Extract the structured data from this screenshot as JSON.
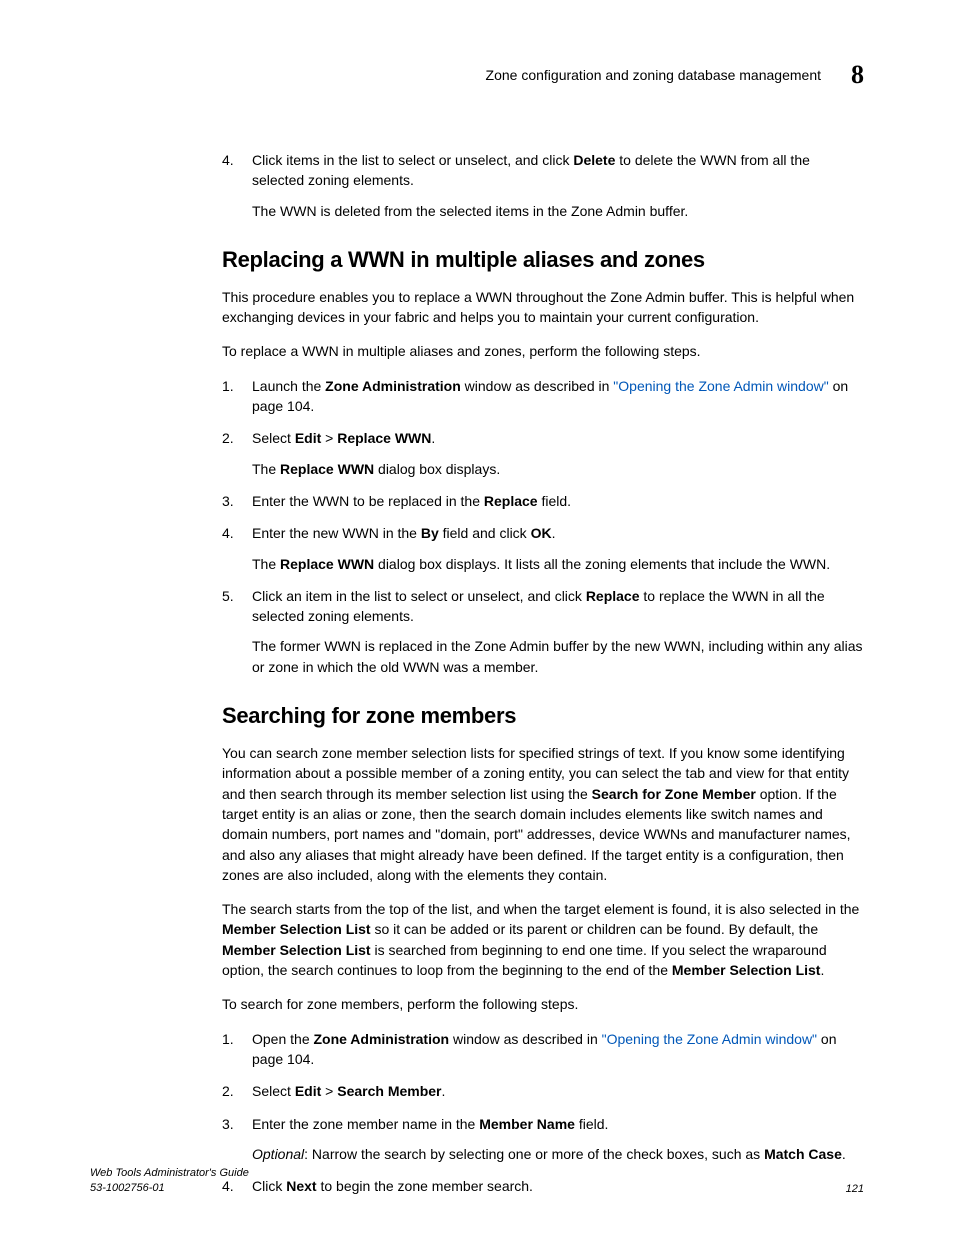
{
  "header": {
    "running_title": "Zone configuration and zoning database management",
    "chapter_number": "8"
  },
  "section_a": {
    "step4_a": "Click items in the list to select or unselect, and click ",
    "step4_b": "Delete",
    "step4_c": " to delete the WWN from all the selected zoning elements.",
    "step4_sub": "The WWN is deleted from the selected items in the Zone Admin buffer."
  },
  "section_b": {
    "heading": "Replacing a WWN in multiple aliases and zones",
    "intro": "This procedure enables you to replace a WWN throughout the Zone Admin buffer. This is helpful when exchanging devices in your fabric and helps you to maintain your current configuration.",
    "lead": "To replace a WWN in multiple aliases and zones, perform the following steps.",
    "s1_a": "Launch the ",
    "s1_b": "Zone Administration",
    "s1_c": " window as described in ",
    "s1_link": "\"Opening the Zone Admin window\"",
    "s1_d": " on page 104.",
    "s2_a": "Select ",
    "s2_b": "Edit",
    "s2_gt": " > ",
    "s2_c": "Replace WWN",
    "s2_d": ".",
    "s2_sub_a": "The ",
    "s2_sub_b": "Replace WWN",
    "s2_sub_c": " dialog box displays.",
    "s3_a": "Enter the WWN to be replaced in the ",
    "s3_b": "Replace",
    "s3_c": " field.",
    "s4_a": "Enter the new WWN in the ",
    "s4_b": "By",
    "s4_c": " field and click ",
    "s4_d": "OK",
    "s4_e": ".",
    "s4_sub_a": "The ",
    "s4_sub_b": "Replace WWN",
    "s4_sub_c": " dialog box displays. It lists all the zoning elements that include the WWN.",
    "s5_a": "Click an item in the list to select or unselect, and click ",
    "s5_b": "Replace",
    "s5_c": " to replace the WWN in all the selected zoning elements.",
    "s5_sub": "The former WWN is replaced in the Zone Admin buffer by the new WWN, including within any alias or zone in which the old WWN was a member."
  },
  "section_c": {
    "heading": "Searching for zone members",
    "p1_a": "You can search zone member selection lists for specified strings of text. If you know some identifying information about a possible member of a zoning entity, you can select the tab and view for that entity and then search through its member selection list using the ",
    "p1_b": "Search for Zone Member",
    "p1_c": " option. If the target entity is an alias or zone, then the search domain includes elements like switch names and domain numbers, port names and \"domain, port\" addresses, device WWNs and manufacturer names, and also any aliases that might already have been defined. If the target entity is a configuration, then zones are also included, along with the elements they contain.",
    "p2_a": "The search starts from the top of the list, and when the target element is found, it is also selected in the ",
    "p2_b": "Member Selection List",
    "p2_c": " so it can be added or its parent or children can be found. By default, the ",
    "p2_d": "Member Selection List",
    "p2_e": " is searched from beginning to end one time. If you select the wraparound option, the search continues to loop from the beginning to the end of the ",
    "p2_f": "Member Selection List",
    "p2_g": ".",
    "lead": "To search for zone members, perform the following steps.",
    "s1_a": "Open the ",
    "s1_b": "Zone Administration",
    "s1_c": " window as described in ",
    "s1_link": "\"Opening the Zone Admin window\"",
    "s1_d": " on page 104.",
    "s2_a": "Select ",
    "s2_b": "Edit",
    "s2_gt": " > ",
    "s2_c": "Search Member",
    "s2_d": ".",
    "s3_a": "Enter the zone member name in the ",
    "s3_b": "Member Name",
    "s3_c": " field.",
    "s3_sub_a": "Optional",
    "s3_sub_b": ": Narrow the search by selecting one or more of the check boxes, such as ",
    "s3_sub_c": "Match Case",
    "s3_sub_d": ".",
    "s4_a": "Click ",
    "s4_b": "Next",
    "s4_c": " to begin the zone member search."
  },
  "footer": {
    "title": "Web Tools Administrator's Guide",
    "docnum": "53-1002756-01",
    "page": "121"
  }
}
